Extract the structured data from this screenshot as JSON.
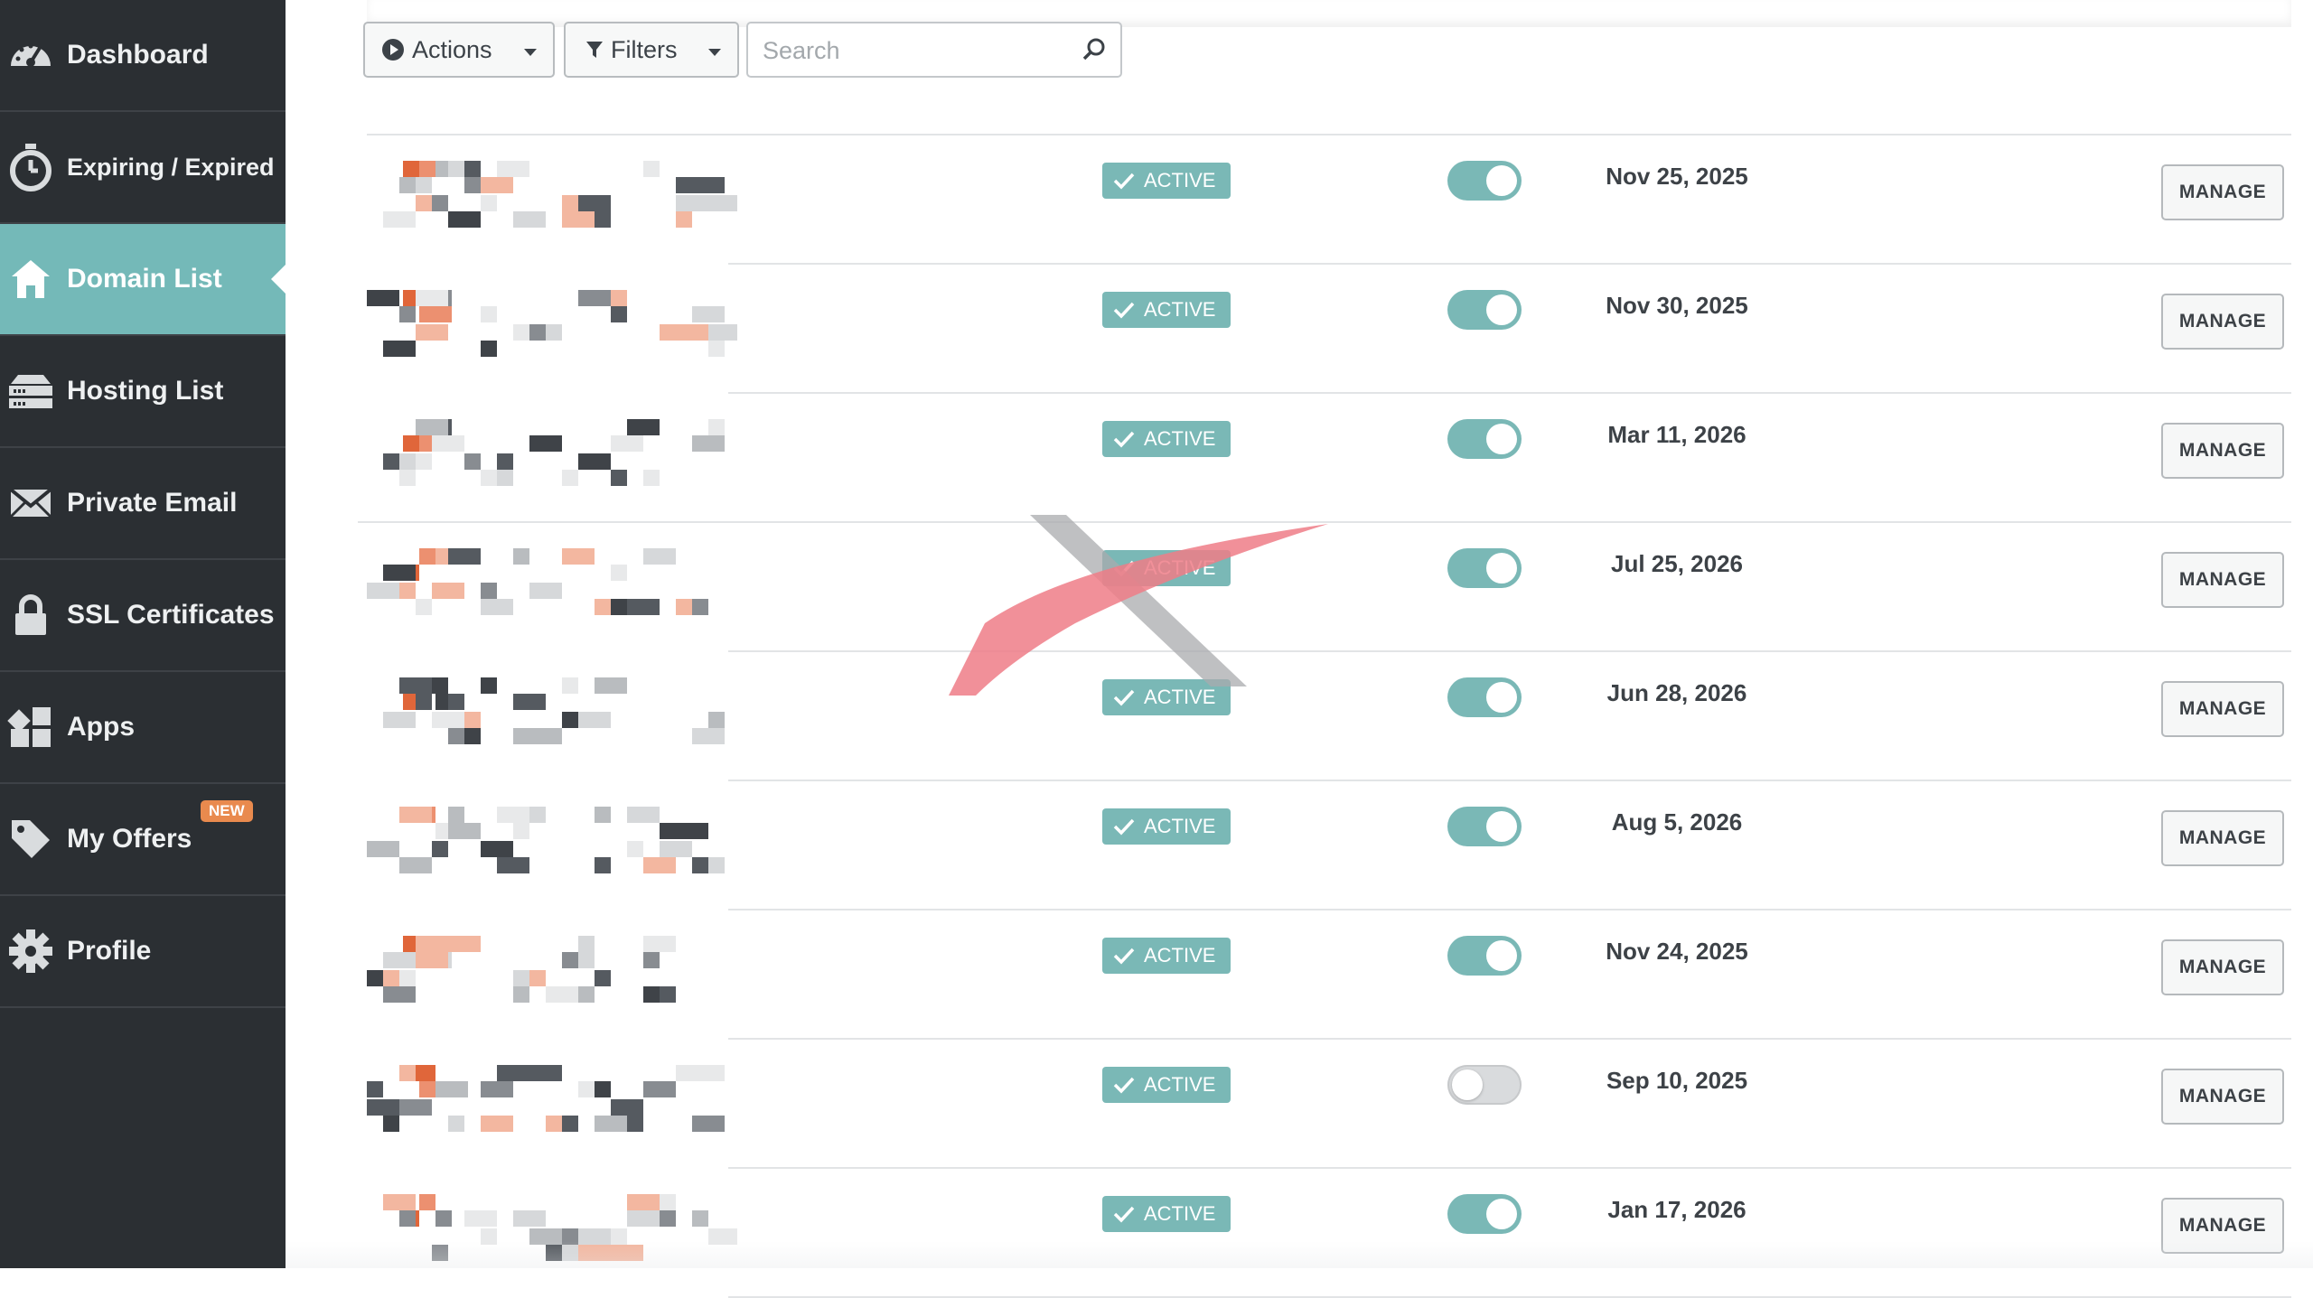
{
  "sidebar": {
    "items": [
      {
        "label": "Dashboard",
        "icon": "speedometer-icon",
        "active": false
      },
      {
        "label": "Expiring / Expired",
        "icon": "stopwatch-icon",
        "active": false
      },
      {
        "label": "Domain List",
        "icon": "home-icon",
        "active": true
      },
      {
        "label": "Hosting List",
        "icon": "server-icon",
        "active": false
      },
      {
        "label": "Private Email",
        "icon": "envelope-icon",
        "active": false
      },
      {
        "label": "SSL Certificates",
        "icon": "lock-icon",
        "active": false
      },
      {
        "label": "Apps",
        "icon": "apps-grid-icon",
        "active": false
      },
      {
        "label": "My Offers",
        "icon": "tag-icon",
        "active": false,
        "badge": "NEW"
      },
      {
        "label": "Profile",
        "icon": "gear-icon",
        "active": false
      }
    ]
  },
  "toolbar": {
    "actions_label": "Actions",
    "filters_label": "Filters",
    "search_placeholder": "Search",
    "search_value": ""
  },
  "rows": [
    {
      "status": "ACTIVE",
      "auto_renew": true,
      "expires": "Nov 25, 2025",
      "action": "MANAGE"
    },
    {
      "status": "ACTIVE",
      "auto_renew": true,
      "expires": "Nov 30, 2025",
      "action": "MANAGE"
    },
    {
      "status": "ACTIVE",
      "auto_renew": true,
      "expires": "Mar 11, 2026",
      "action": "MANAGE"
    },
    {
      "status": "ACTIVE",
      "auto_renew": true,
      "expires": "Jul 25, 2026",
      "action": "MANAGE"
    },
    {
      "status": "ACTIVE",
      "auto_renew": true,
      "expires": "Jun 28, 2026",
      "action": "MANAGE"
    },
    {
      "status": "ACTIVE",
      "auto_renew": true,
      "expires": "Aug 5, 2026",
      "action": "MANAGE"
    },
    {
      "status": "ACTIVE",
      "auto_renew": true,
      "expires": "Nov 24, 2025",
      "action": "MANAGE"
    },
    {
      "status": "ACTIVE",
      "auto_renew": false,
      "expires": "Sep 10, 2025",
      "action": "MANAGE"
    },
    {
      "status": "ACTIVE",
      "auto_renew": true,
      "expires": "Jan 17, 2026",
      "action": "MANAGE"
    }
  ],
  "colors": {
    "sidebar_bg": "#2b2f33",
    "accent_teal": "#74b9b8",
    "badge_orange": "#e98a4e",
    "brand_orange": "#e0663a"
  }
}
